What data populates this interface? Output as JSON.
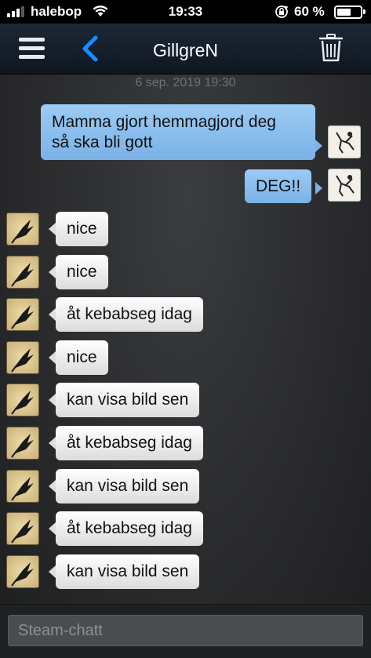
{
  "status_bar": {
    "carrier": "halebop",
    "time": "19:33",
    "battery_percent": "60 %",
    "battery_level": 0.6,
    "signal_bars": 3
  },
  "nav": {
    "title": "GillgreN"
  },
  "chat": {
    "timestamp": "6 sep. 2019 19:30",
    "outgoing": [
      {
        "line1": "Mamma gjort hemmagjord deg",
        "line2": "så ska bli gott"
      },
      {
        "text": "DEG!!"
      }
    ],
    "incoming": [
      "nice",
      "nice",
      "åt kebabseg idag",
      "nice",
      "kan visa bild sen",
      "åt kebabseg idag",
      "kan visa bild sen",
      "åt kebabseg idag",
      "kan visa bild sen"
    ]
  },
  "input": {
    "placeholder": "Steam-chatt"
  },
  "colors": {
    "accent_blue": "#1a8cff",
    "outgoing_bubble": "#8fc1f0",
    "incoming_bubble": "#efefef",
    "navbar": "#151e2a"
  }
}
